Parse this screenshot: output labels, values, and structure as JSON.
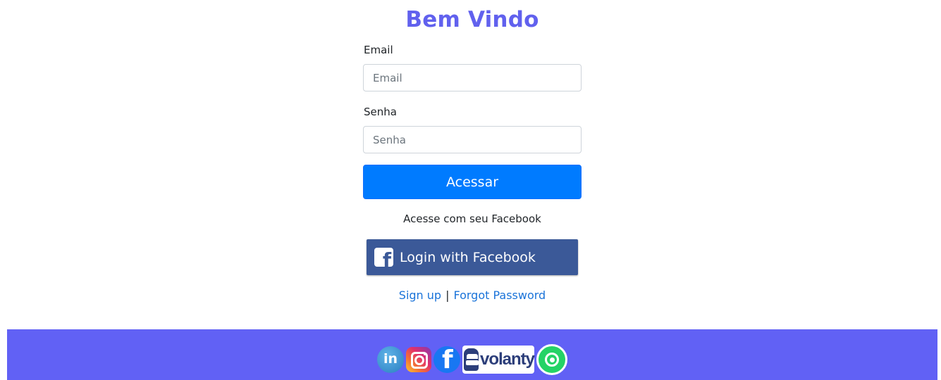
{
  "page": {
    "title": "Bem Vindo"
  },
  "form": {
    "email_label": "Email",
    "email_placeholder": "Email",
    "password_label": "Senha",
    "password_placeholder": "Senha",
    "submit_label": "Acessar"
  },
  "facebook": {
    "prompt": "Acesse com seu Facebook",
    "button_label": "Login with Facebook",
    "logo_glyph": "f"
  },
  "links": {
    "signup": "Sign up",
    "separator": "|",
    "forgot": "Forgot Password"
  },
  "footer": {
    "background_color": "#6161f5",
    "social": [
      {
        "name": "linkedin-icon",
        "glyph": "in"
      },
      {
        "name": "instagram-icon"
      },
      {
        "name": "facebook-icon",
        "glyph": "f"
      },
      {
        "name": "volanty-logo",
        "text": "volanty"
      },
      {
        "name": "whatsapp-icon"
      }
    ]
  },
  "colors": {
    "title": "#6161ee",
    "primary_button": "#007bff",
    "facebook_button": "#3b5998",
    "link": "#1a73d9"
  }
}
